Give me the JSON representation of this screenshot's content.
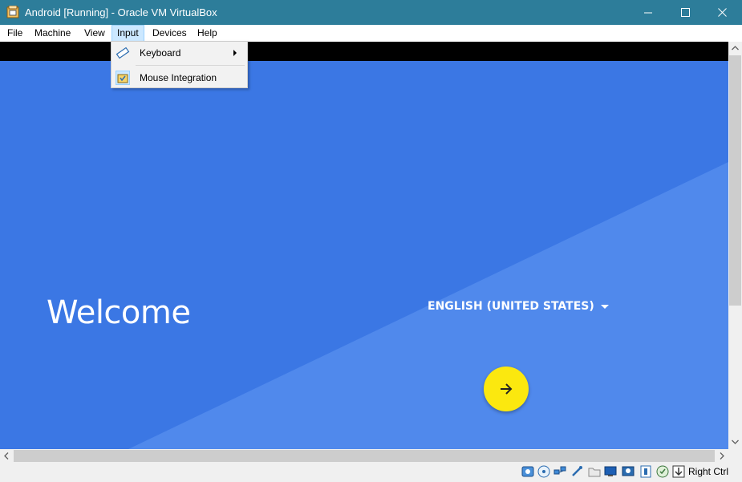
{
  "window": {
    "title": "Android [Running] - Oracle VM VirtualBox",
    "titlebar_color": "#2d7d9a"
  },
  "menubar": {
    "items": [
      {
        "label": "File"
      },
      {
        "label": "Machine"
      },
      {
        "label": "View"
      },
      {
        "label": "Input",
        "open": true
      },
      {
        "label": "Devices"
      },
      {
        "label": "Help"
      }
    ]
  },
  "input_menu": {
    "items": [
      {
        "label": "Keyboard",
        "icon": "keyboard-icon",
        "has_submenu": true
      },
      {
        "label": "Mouse Integration",
        "icon": "mouse-integration-icon"
      }
    ]
  },
  "guest_screen": {
    "welcome_text": "Welcome",
    "language": "ENGLISH (UNITED STATES)",
    "next_button_icon": "arrow-right-icon",
    "background_color": "#3a76e3",
    "accent_color": "#fbe80f"
  },
  "statusbar": {
    "icons": [
      "hard-disk-icon",
      "optical-drive-icon",
      "network-icon",
      "usb-icon",
      "shared-folders-icon",
      "display-icon",
      "video-capture-icon",
      "vt-x-icon",
      "mouse-integration-icon",
      "keyboard-capture-icon"
    ],
    "host_key": "Right Ctrl"
  }
}
